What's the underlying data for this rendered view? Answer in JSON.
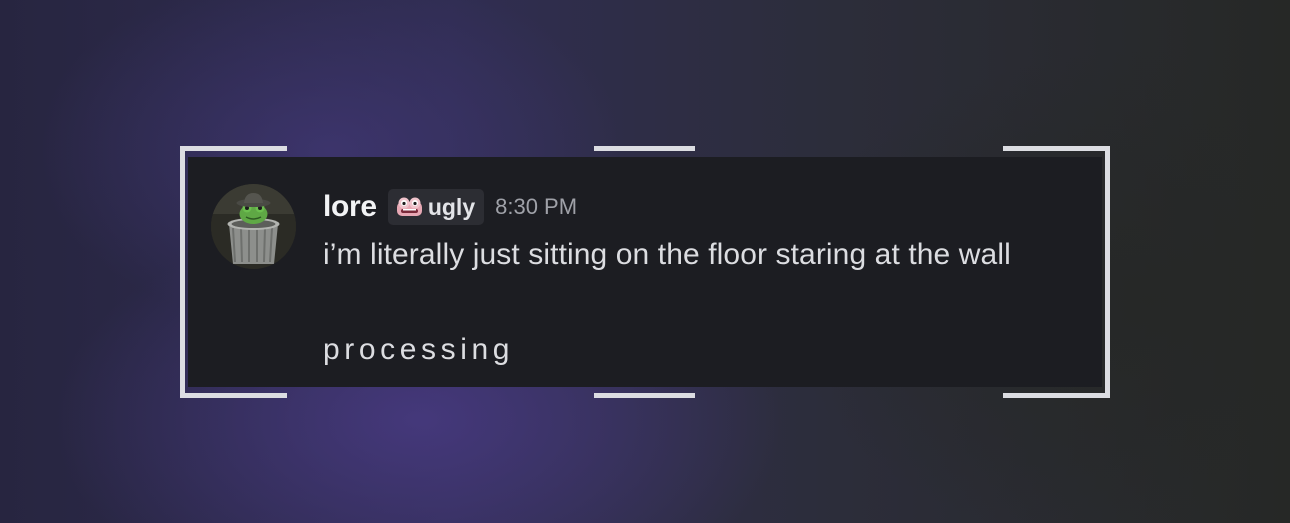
{
  "message": {
    "username": "lore",
    "role_tag": {
      "icon": "frog-face-icon",
      "label": "ugly"
    },
    "timestamp": "8:30 PM",
    "lines": [
      "i’m literally just sitting on the floor staring at the wall",
      "processing"
    ],
    "avatar": "frog-in-trash-can-avatar"
  },
  "colors": {
    "card_background": "#1c1d22",
    "username": "#f2f3f5",
    "text": "#dcdde1",
    "timestamp": "#9fa1a8",
    "frame": "#dcdde2"
  }
}
